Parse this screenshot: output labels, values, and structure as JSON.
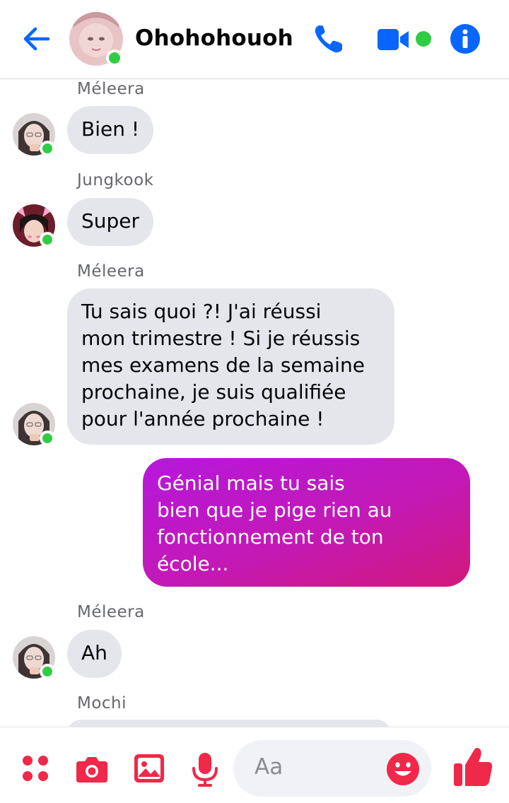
{
  "header": {
    "title": "Ohohohouoh",
    "accent": "#0866ff",
    "online_color": "#31cc46"
  },
  "messages": [
    {
      "sender": "Méleera",
      "text": "Bien !"
    },
    {
      "sender": "Jungkook",
      "text": "Super"
    },
    {
      "sender": "Méleera",
      "lines": [
        "Tu sais quoi ?! J'ai réussi",
        "mon trimestre ! Si je réussis",
        "mes examens de la semaine",
        "prochaine, je suis qualifiée",
        "pour l'année prochaine !"
      ]
    },
    {
      "sender": "me",
      "lines": [
        "Génial mais tu sais",
        "bien que je pige rien au",
        "fonctionnement de ton",
        "école..."
      ]
    },
    {
      "sender": "Méleera",
      "text": "Ah"
    },
    {
      "sender": "Mochi",
      "text": ""
    }
  ],
  "composer": {
    "placeholder": "Aa",
    "accent": "#f02849",
    "icons": [
      "apps-icon",
      "camera-icon",
      "gallery-icon",
      "microphone-icon",
      "emoji-icon",
      "thumbs-up-icon"
    ]
  },
  "colors": {
    "incoming_bubble": "#e4e6eb",
    "outgoing_gradient": [
      "#b618dc",
      "#d2197a"
    ]
  }
}
